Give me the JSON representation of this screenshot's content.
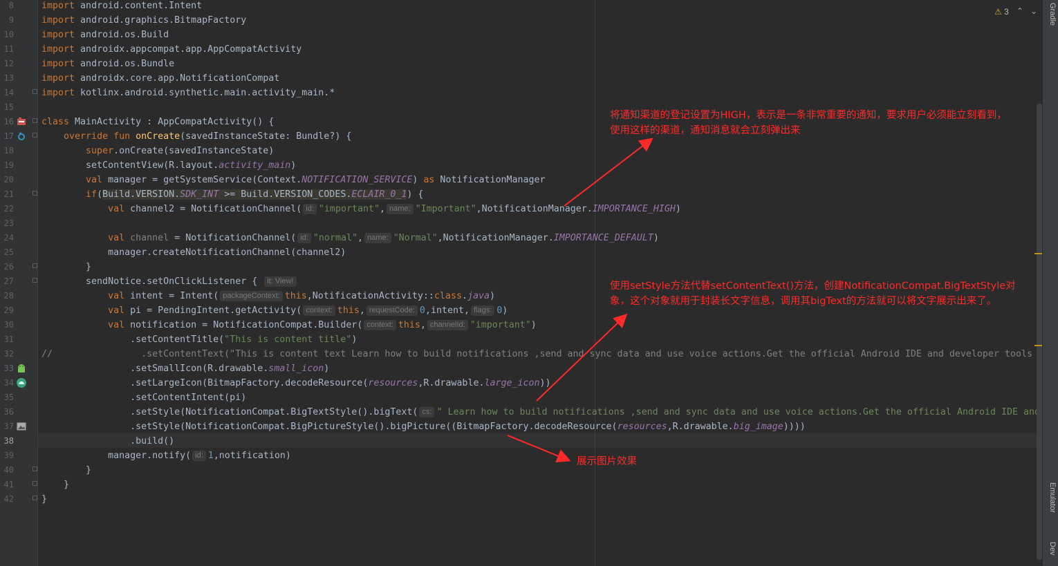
{
  "editor": {
    "lines": [
      {
        "n": "8",
        "html": "<span class='kw'>import</span> android.content.Intent"
      },
      {
        "n": "9",
        "html": "<span class='kw'>import</span> android.graphics.BitmapFactory"
      },
      {
        "n": "10",
        "html": "<span class='kw'>import</span> android.os.Build"
      },
      {
        "n": "11",
        "html": "<span class='kw'>import</span> androidx.appcompat.app.AppCompatActivity"
      },
      {
        "n": "12",
        "html": "<span class='kw'>import</span> android.os.Bundle"
      },
      {
        "n": "13",
        "html": "<span class='kw'>import</span> androidx.core.app.NotificationCompat"
      },
      {
        "n": "14",
        "html": "<span class='kw'>import</span> kotlinx.android.synthetic.main.activity_main.*"
      },
      {
        "n": "15",
        "html": ""
      },
      {
        "n": "16",
        "html": "<span class='kw'>class</span> MainActivity : AppCompatActivity() {"
      },
      {
        "n": "17",
        "html": "    <span class='kw'>override fun</span> <span class='fn'>onCreate</span>(savedInstanceState: Bundle?) {"
      },
      {
        "n": "18",
        "html": "        <span class='kw'>super</span>.onCreate(savedInstanceState)"
      },
      {
        "n": "19",
        "html": "        setContentView(R.layout.<span class='it'>activity_main</span>)"
      },
      {
        "n": "20",
        "html": "        <span class='kw'>val</span> manager = getSystemService(Context.<span class='it'>NOTIFICATION_SERVICE</span>) <span class='kw'>as</span> NotificationManager"
      },
      {
        "n": "21",
        "html": "        <span class='kw'>if</span>(<span class='hl'>Build.VERSION.<span class='it'>SDK_INT</span> &gt;= Build.VERSION_CODES.<span class='it'>ECLAIR_0_1</span></span>) {"
      },
      {
        "n": "22",
        "html": "            <span class='kw'>val</span> channel2 = NotificationChannel(<span class='hint'>id:</span><span class='str'>\"important\"</span>,<span class='hint'>name:</span><span class='str'>\"Important\"</span>,NotificationManager.<span class='it'>IMPORTANCE_HIGH</span>)"
      },
      {
        "n": "23",
        "html": ""
      },
      {
        "n": "24",
        "html": "            <span class='kw'>val</span> <span class='cm'>channel</span> = NotificationChannel(<span class='hint'>id:</span><span class='str'>\"normal\"</span>,<span class='hint'>name:</span><span class='str'>\"Normal\"</span>,NotificationManager.<span class='it'>IMPORTANCE_DEFAULT</span>)"
      },
      {
        "n": "25",
        "html": "            manager.createNotificationChannel(channel2)"
      },
      {
        "n": "26",
        "html": "        }"
      },
      {
        "n": "27",
        "html": "        sendNotice.setOnClickListener { <span class='hint'>it: View!</span>"
      },
      {
        "n": "28",
        "html": "            <span class='kw'>val</span> intent = Intent(<span class='hint'>packageContext:</span><span class='kw'>this</span>,NotificationActivity::<span class='kw'>class</span>.<span class='it'>java</span>)"
      },
      {
        "n": "29",
        "html": "            <span class='kw'>val</span> pi = PendingIntent.getActivity(<span class='hint'>context:</span><span class='kw'>this</span>,<span class='hint'>requestCode:</span><span class='num'>0</span>,intent,<span class='hint'>flags:</span><span class='num'>0</span>)"
      },
      {
        "n": "30",
        "html": "            <span class='kw'>val</span> notification = NotificationCompat.Builder(<span class='hint'>context:</span><span class='kw'>this</span>,<span class='hint'>channelId:</span><span class='str'>\"important\"</span>)"
      },
      {
        "n": "31",
        "html": "                .setContentTitle(<span class='str'>\"This is content title\"</span>)"
      },
      {
        "n": "32",
        "html": "<span class='cm'>//                .setContentText(\"This is content text Learn how to build notifications ,send and sync data and use voice actions.Get the official Android IDE and developer tools to build apps for Android.\")</span>"
      },
      {
        "n": "33",
        "html": "                .setSmallIcon(R.drawable.<span class='it'>small_icon</span>)"
      },
      {
        "n": "34",
        "html": "                .setLargeIcon(BitmapFactory.decodeResource(<span class='it'>resources</span>,R.drawable.<span class='it'>large_icon</span>))"
      },
      {
        "n": "35",
        "html": "                .setContentIntent(pi)"
      },
      {
        "n": "36",
        "html": "                .setStyle(NotificationCompat.BigTextStyle().bigText(<span class='hint'>cs:</span><span class='str'>\" Learn how to build notifications ,send and sync data and use voice actions.Get the official Android IDE and developer tools\"</span>))"
      },
      {
        "n": "37",
        "html": "                .setStyle(NotificationCompat.BigPictureStyle().bigPicture((BitmapFactory.decodeResource(<span class='it'>resources</span>,R.drawable.<span class='it'>big_image</span>))))"
      },
      {
        "n": "38",
        "html": "                .build()"
      },
      {
        "n": "39",
        "html": "            manager.notify(<span class='hint'>id:</span><span class='num'>1</span>,notification)"
      },
      {
        "n": "40",
        "html": "        }"
      },
      {
        "n": "41",
        "html": "    }"
      },
      {
        "n": "42",
        "html": "}"
      }
    ]
  },
  "status": {
    "warning_count": "3",
    "warning_icon": "warning-triangle-icon"
  },
  "toolwindows": {
    "gradle": "Gradle",
    "emulator": "Emulator",
    "device": "Dev"
  },
  "annotations": {
    "a1_line1": "将通知渠道的登记设置为HIGH，表示是一条非常重要的通知，要求用户必须能立刻看到，",
    "a1_line2": "使用这样的渠道，通知消息就会立刻弹出来",
    "a2_line1": "使用setStyle方法代替setContentText()方法，创建NotificationCompat.BigTextStyle对",
    "a2_line2": "象，这个对象就用于封装长文字信息，调用其bigText的方法就可以将文字展示出来了。",
    "a3": "展示图片效果"
  },
  "colors": {
    "background": "#2b2b2b",
    "keyword": "#cc7832",
    "string": "#6a8759",
    "annotation": "#ff2a2a"
  }
}
